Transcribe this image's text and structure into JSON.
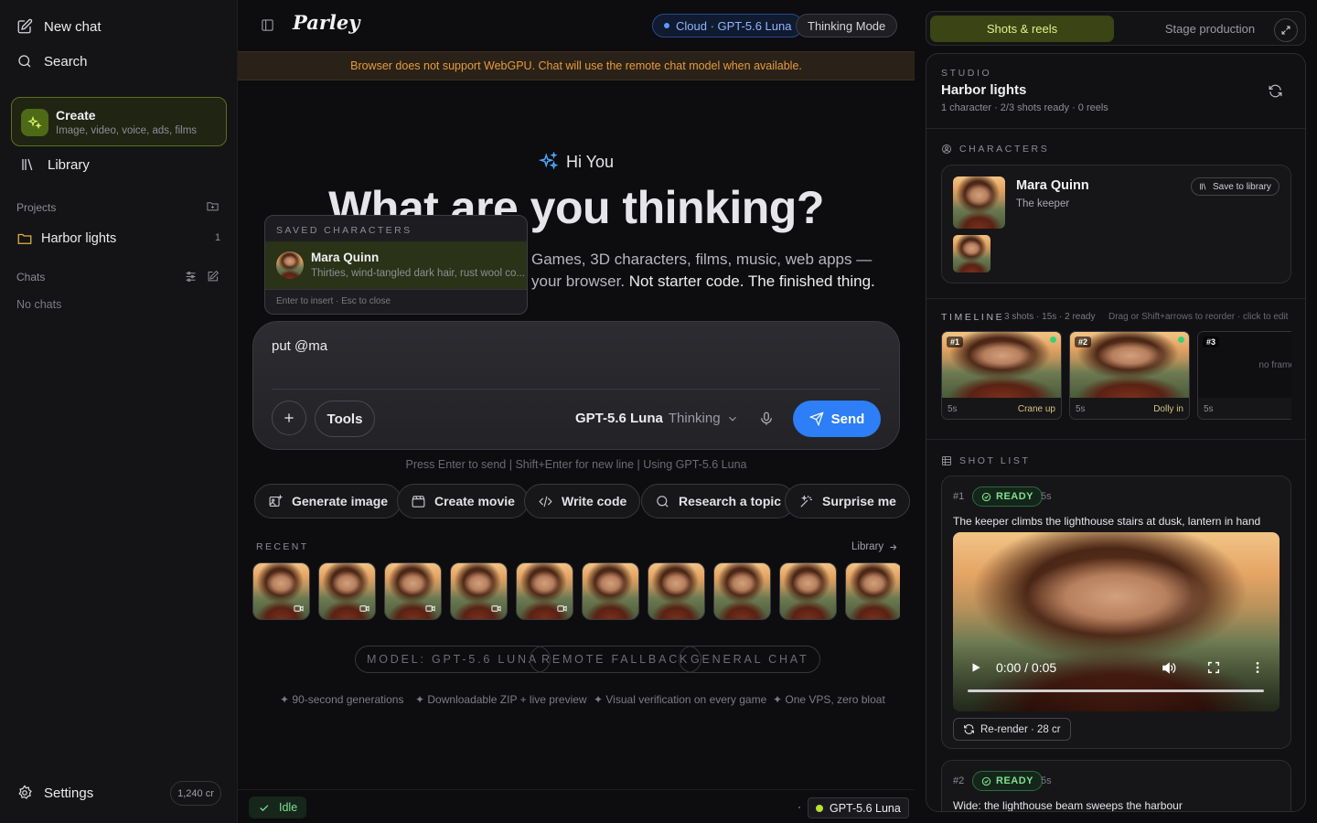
{
  "sidebar": {
    "new_chat": "New chat",
    "search": "Search",
    "create": {
      "title": "Create",
      "subtitle": "Image, video, voice, ads, films"
    },
    "library": "Library",
    "projects_label": "Projects",
    "projects": [
      {
        "name": "Harbor lights",
        "count": "1"
      }
    ],
    "chats_label": "Chats",
    "no_chats": "No chats",
    "settings": "Settings",
    "credits": "1,240 cr"
  },
  "topbar": {
    "logo": "Parley",
    "model_pill": "Cloud · GPT-5.6 Luna",
    "thinking_pill": "Thinking Mode"
  },
  "banner": "Browser does not support WebGPU. Chat will use the remote chat model when available.",
  "hero": {
    "greeting": "Hi You",
    "headline": "What are you thinking?",
    "sub_line1": "Games, 3D characters, films, music, web apps —",
    "sub_line2_dim": "your browser.",
    "sub_line2_bright": "Not starter code. The finished thing."
  },
  "popup": {
    "title": "SAVED CHARACTERS",
    "items": [
      {
        "name": "Mara Quinn",
        "desc": "Thirties, wind-tangled dark hair, rust wool co..."
      }
    ],
    "footer": "Enter to insert · Esc to close"
  },
  "composer": {
    "value": "put @ma",
    "tools": "Tools",
    "model": "GPT-5.6 Luna",
    "mode": "Thinking",
    "send": "Send"
  },
  "hint": "Press Enter to send | Shift+Enter for new line | Using GPT-5.6 Luna",
  "chips": [
    "Generate image",
    "Create movie",
    "Write code",
    "Research a topic",
    "Surprise me"
  ],
  "recent": {
    "label": "RECENT",
    "library_link": "Library"
  },
  "tags": [
    "MODEL: GPT-5.6 LUNA",
    "REMOTE FALLBACK",
    "GENERAL CHAT"
  ],
  "features": [
    "✦ 90-second generations",
    "✦ Downloadable ZIP + live preview",
    "✦ Visual verification on every game",
    "✦ One VPS, zero bloat"
  ],
  "footer": {
    "status": "Idle",
    "model": "GPT-5.6 Luna"
  },
  "right_panel": {
    "tabs": [
      "Shots & reels",
      "Stage production"
    ],
    "active_tab": "Shots & reels",
    "studio_label": "STUDIO",
    "project_title": "Harbor lights",
    "project_meta": "1 character · 2/3 shots ready · 0 reels",
    "characters_label": "CHARACTERS",
    "character": {
      "name": "Mara Quinn",
      "role": "The keeper",
      "save": "Save to library"
    },
    "timeline_label": "TIMELINE",
    "timeline_meta": "3 shots · 15s · 2 ready",
    "timeline_hint": "Drag or Shift+arrows to reorder · click to edit",
    "timeline": [
      {
        "num": "#1",
        "dur": "5s",
        "move": "Crane up"
      },
      {
        "num": "#2",
        "dur": "5s",
        "move": "Dolly in"
      },
      {
        "num": "#3",
        "dur": "5s",
        "move": "",
        "empty": "no frame yet"
      }
    ],
    "shot_list_label": "SHOT LIST",
    "shots": [
      {
        "num": "#1",
        "status": "READY",
        "dur": "5s",
        "desc": "The keeper climbs the lighthouse stairs at dusk, lantern in hand",
        "time": "0:00 / 0:05",
        "rerender": "Re-render · 28 cr"
      },
      {
        "num": "#2",
        "status": "READY",
        "dur": "5s",
        "desc": "Wide: the lighthouse beam sweeps the harbour"
      }
    ]
  },
  "colors": {
    "accent_blue": "#2d7ef7",
    "create_green": "#5d6e1e",
    "ready_green": "#7fe08f",
    "warning_orange": "#e89a3c"
  }
}
